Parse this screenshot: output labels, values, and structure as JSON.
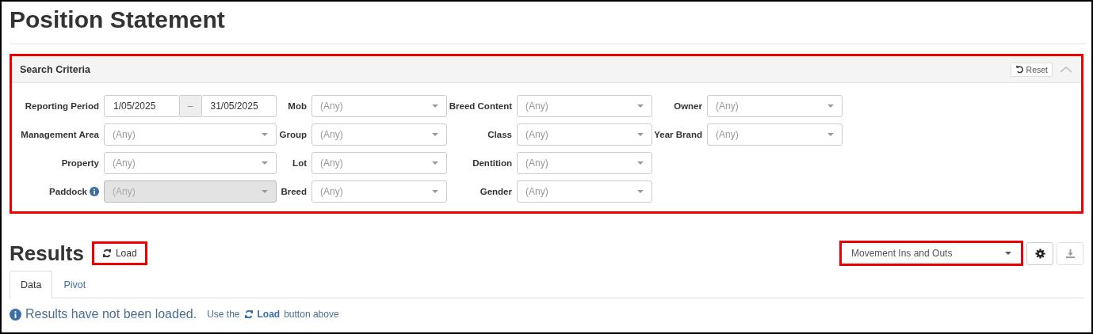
{
  "page_title": "Position Statement",
  "search_panel": {
    "title": "Search Criteria",
    "highlighted": true,
    "reset_button": "Reset",
    "collapsed": false,
    "columns": [
      {
        "fields": [
          {
            "label": "Reporting Period",
            "kind": "date_range",
            "from": "1/05/2025",
            "separator": "–",
            "to": "31/05/2025"
          },
          {
            "label": "Management Area",
            "kind": "select",
            "placeholder": "(Any)",
            "disabled": false
          },
          {
            "label": "Property",
            "kind": "select",
            "placeholder": "(Any)",
            "disabled": false
          },
          {
            "label": "Paddock",
            "kind": "select",
            "placeholder": "(Any)",
            "disabled": true,
            "info": true
          }
        ]
      },
      {
        "fields": [
          {
            "label": "Mob",
            "kind": "select",
            "placeholder": "(Any)",
            "disabled": false
          },
          {
            "label": "Group",
            "kind": "select",
            "placeholder": "(Any)",
            "disabled": false
          },
          {
            "label": "Lot",
            "kind": "select",
            "placeholder": "(Any)",
            "disabled": false
          },
          {
            "label": "Breed",
            "kind": "select",
            "placeholder": "(Any)",
            "disabled": false
          }
        ]
      },
      {
        "fields": [
          {
            "label": "Breed Content",
            "kind": "select",
            "placeholder": "(Any)",
            "disabled": false
          },
          {
            "label": "Class",
            "kind": "select",
            "placeholder": "(Any)",
            "disabled": false
          },
          {
            "label": "Dentition",
            "kind": "select",
            "placeholder": "(Any)",
            "disabled": false
          },
          {
            "label": "Gender",
            "kind": "select",
            "placeholder": "(Any)",
            "disabled": false
          }
        ]
      },
      {
        "fields": [
          {
            "label": "Owner",
            "kind": "select",
            "placeholder": "(Any)",
            "disabled": false
          },
          {
            "label": "Year Brand",
            "kind": "select",
            "placeholder": "(Any)",
            "disabled": false
          }
        ]
      }
    ]
  },
  "results": {
    "title": "Results",
    "load_button": {
      "label": "Load",
      "highlighted": true
    },
    "view_select": {
      "value": "Movement Ins and Outs",
      "highlighted": true
    },
    "download_disabled": true,
    "tabs": [
      {
        "label": "Data",
        "selected": true
      },
      {
        "label": "Pivot",
        "selected": false
      }
    ],
    "message": "Results have not been loaded.",
    "hint_before": "Use the",
    "hint_button": "Load",
    "hint_after": "button above"
  }
}
